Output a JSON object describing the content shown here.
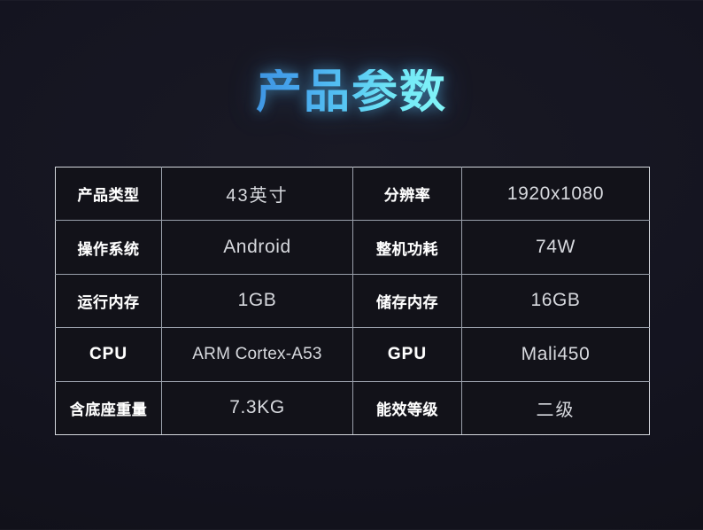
{
  "page": {
    "title": "产品参数",
    "background_color": "#15151d",
    "title_gradient_from": "#3d93e0",
    "title_gradient_to": "#84f6f8"
  },
  "spec_table": {
    "rows": [
      {
        "label_left": "产品类型",
        "value_left": "43英寸",
        "label_right": "分辨率",
        "value_right": "1920x1080"
      },
      {
        "label_left": "操作系统",
        "value_left": "Android",
        "label_right": "整机功耗",
        "value_right": "74W"
      },
      {
        "label_left": "运行内存",
        "value_left": "1GB",
        "label_right": "储存内存",
        "value_right": "16GB"
      },
      {
        "label_left": "CPU",
        "value_left": "ARM Cortex-A53",
        "label_right": "GPU",
        "value_right": "Mali450"
      },
      {
        "label_left": "含底座重量",
        "value_left": "7.3KG",
        "label_right": "能效等级",
        "value_right": "二级"
      }
    ]
  }
}
